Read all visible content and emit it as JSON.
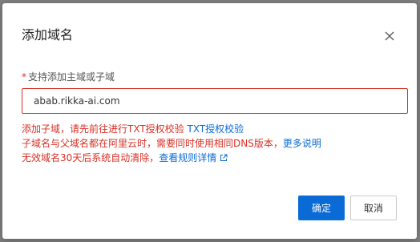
{
  "dialog": {
    "title": "添加域名",
    "close_icon": "close-icon"
  },
  "form": {
    "label_required_mark": "*",
    "label": "支持添加主域或子域",
    "input_value": "abab.rikka-ai.com"
  },
  "errors": {
    "line1_text": "添加子域，请先前往进行TXT授权校验",
    "line1_link": "TXT授权校验",
    "line2_text": "子域名与父域名都在阿里云时，需要同时使用相同DNS版本，",
    "line2_link": "更多说明",
    "line3_text": "无效域名30天后系统自动清除，",
    "line3_link": "查看规则详情",
    "line3_icon": "external-link-icon"
  },
  "footer": {
    "confirm_label": "确定",
    "cancel_label": "取消"
  },
  "colors": {
    "primary": "#0a6bd6",
    "error": "#d93026"
  }
}
